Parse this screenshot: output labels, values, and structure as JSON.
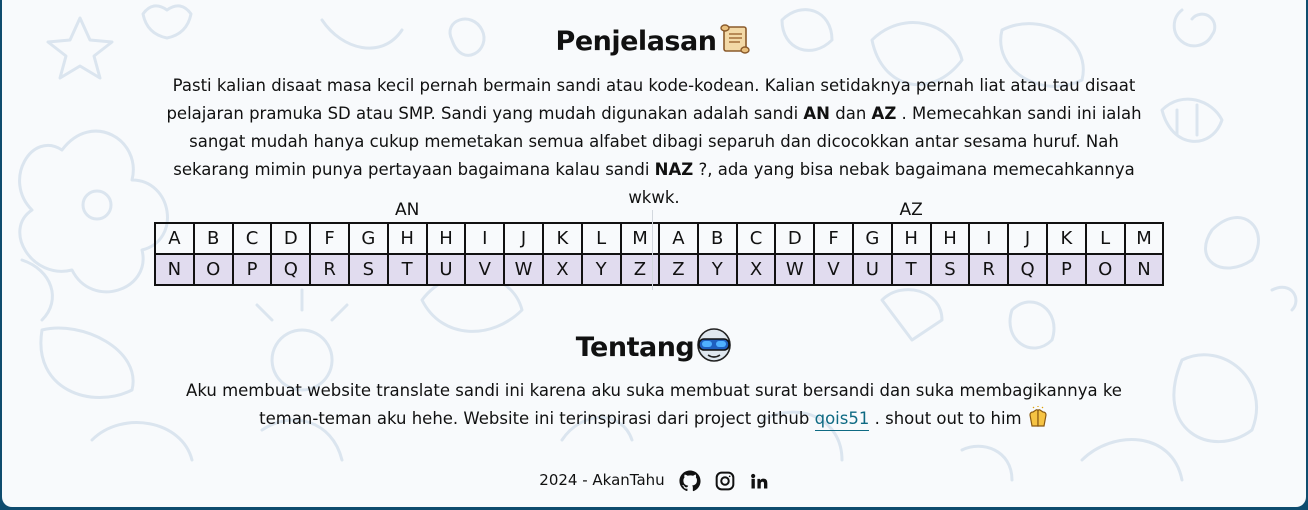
{
  "explanation": {
    "title": "Penjelasan",
    "title_icon": "scroll-icon",
    "text_part1": "Pasti kalian disaat masa kecil pernah bermain sandi atau kode-kodean. Kalian setidaknya pernah liat atau tau disaat pelajaran pramuka SD atau SMP. Sandi yang mudah digunakan adalah sandi ",
    "bold_an": "AN",
    "text_part2": " dan ",
    "bold_az": "AZ",
    "text_part3": " . Memecahkan sandi ini ialah sangat mudah hanya cukup memetakan semua alfabet dibagi separuh dan dicocokkan antar sesama huruf. Nah sekarang mimin punya pertayaan bagaimana kalau sandi ",
    "bold_naz": "NAZ",
    "text_part4": " ?, ada yang bisa nebak bagaimana memecahkannya wkwk."
  },
  "cipher_an": {
    "label": "AN",
    "top": [
      "A",
      "B",
      "C",
      "D",
      "F",
      "G",
      "H",
      "H",
      "I",
      "J",
      "K",
      "L",
      "M"
    ],
    "bottom": [
      "N",
      "O",
      "P",
      "Q",
      "R",
      "S",
      "T",
      "U",
      "V",
      "W",
      "X",
      "Y",
      "Z"
    ]
  },
  "cipher_az": {
    "label": "AZ",
    "top": [
      "A",
      "B",
      "C",
      "D",
      "F",
      "G",
      "H",
      "H",
      "I",
      "J",
      "K",
      "L",
      "M"
    ],
    "bottom": [
      "Z",
      "Y",
      "X",
      "W",
      "V",
      "U",
      "T",
      "S",
      "R",
      "Q",
      "P",
      "O",
      "N"
    ]
  },
  "about": {
    "title": "Tentang",
    "title_icon": "goggles-icon",
    "text_part1": "Aku membuat website translate sandi ini karena aku suka membuat surat bersandi dan suka membagikannya ke teman-teman aku hehe. Website ini terinspirasi dari project github ",
    "link_text": "qois51",
    "text_part2": " . shout out to him ",
    "end_icon": "praising-hands-icon"
  },
  "footer": {
    "text": "2024 - AkanTahu",
    "icons": [
      "github-icon",
      "instagram-icon",
      "linkedin-icon"
    ]
  },
  "colors": {
    "page_bg": "#f8fafc",
    "outer_bg": "#0f4c6e",
    "cipher_bottom_row": "#e1dcef",
    "link": "#0e6a83",
    "doodle": "#dbe5ef"
  }
}
